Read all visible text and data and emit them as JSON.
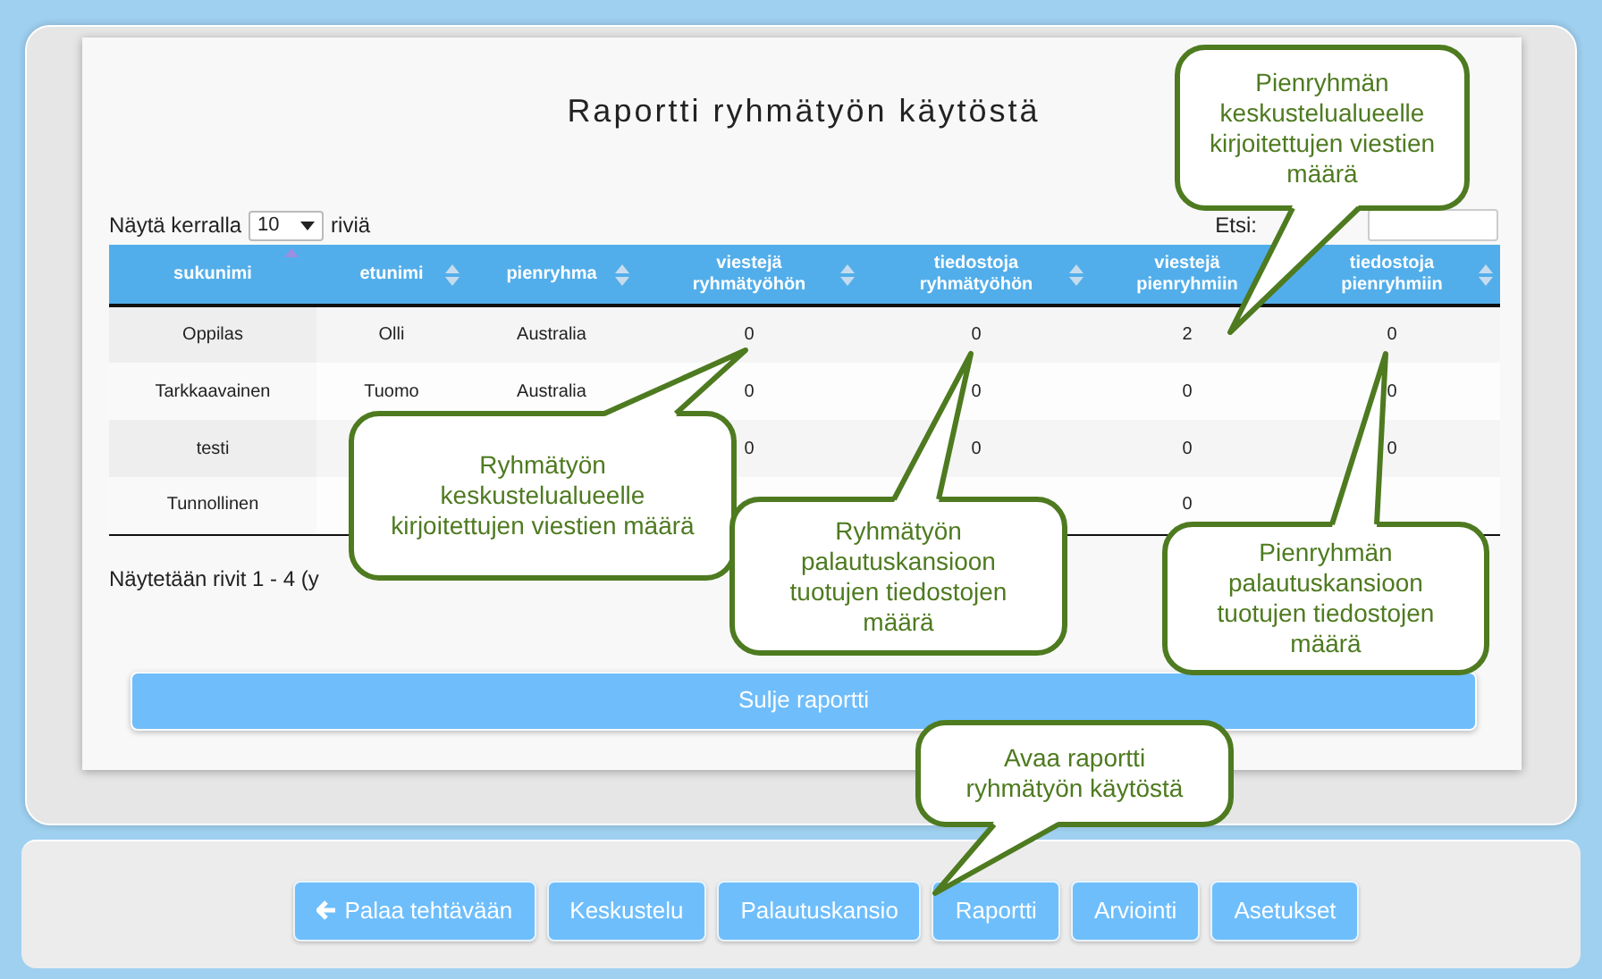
{
  "title": "Raportti ryhmätyön käytöstä",
  "length_menu": {
    "label_before": "Näytä kerralla",
    "value": "10",
    "label_after": "riviä"
  },
  "search": {
    "label": "Etsi:"
  },
  "table": {
    "columns": [
      {
        "label": "sukunimi",
        "sorted": true
      },
      {
        "label": "etunimi",
        "sorted": false
      },
      {
        "label": "pienryhma",
        "sorted": false
      },
      {
        "label": "viestejä ryhmätyöhön",
        "sorted": false
      },
      {
        "label": "tiedostoja ryhmätyöhön",
        "sorted": false
      },
      {
        "label": "viestejä pienryhmiin"
      },
      {
        "label": "tiedostoja pienryhmiin",
        "sorted": false
      }
    ],
    "rows": [
      [
        "Oppilas",
        "Olli",
        "Australia",
        "0",
        "0",
        "2",
        "0"
      ],
      [
        "Tarkkaavainen",
        "Tuomo",
        "Australia",
        "0",
        "0",
        "0",
        "0"
      ],
      [
        "testi",
        null,
        null,
        "0",
        "0",
        "0",
        "0"
      ],
      [
        "Tunnollinen",
        null,
        null,
        null,
        null,
        "0",
        null
      ]
    ]
  },
  "info": "Näytetään rivit 1 - 4 (y",
  "close_button": "Sulje raportti",
  "callouts": [
    {
      "text": "Pienryhmän keskustelualueelle kirjoitettujen viestien määrä"
    },
    {
      "text": "Ryhmätyön keskustelualueelle kirjoitettujen viestien määrä"
    },
    {
      "text": "Ryhmätyön palautuskansioon tuotujen tiedostojen määrä"
    },
    {
      "text": "Pienryhmän palautuskansioon tuotujen tiedostojen määrä"
    },
    {
      "text": "Avaa raportti ryhmätyön käytöstä"
    }
  ],
  "nav_buttons": [
    {
      "label": "Palaa tehtävään",
      "kind": "back"
    },
    {
      "label": "Keskustelu",
      "kind": "plain"
    },
    {
      "label": "Palautuskansio",
      "kind": "plain"
    },
    {
      "label": "Raportti",
      "kind": "plain"
    },
    {
      "label": "Arviointi",
      "kind": "plain"
    },
    {
      "label": "Asetukset",
      "kind": "plain"
    }
  ]
}
